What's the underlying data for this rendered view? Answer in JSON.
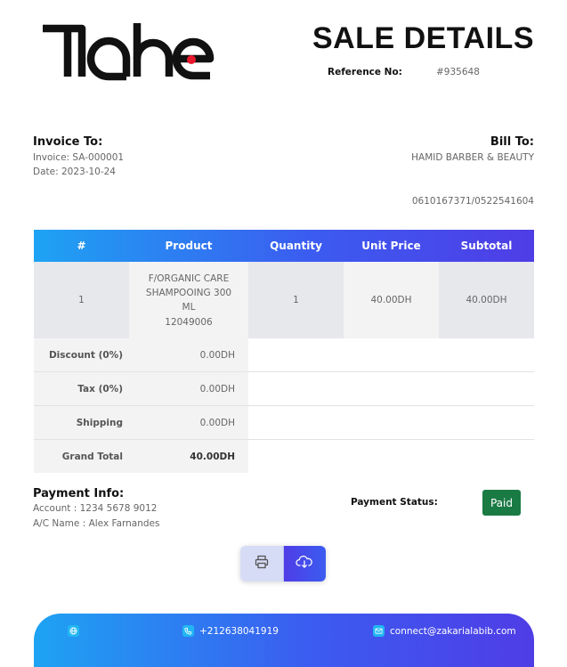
{
  "brand": {
    "logo_text": "Tahe",
    "accent_color": "#e8192c"
  },
  "header": {
    "title": "SALE DETAILS",
    "reference_label": "Reference No:",
    "reference_value": "#935648"
  },
  "invoice_to": {
    "heading": "Invoice To:",
    "invoice": "Invoice: SA-000001",
    "date": "Date: 2023-10-24"
  },
  "bill_to": {
    "heading": "Bill To:",
    "name": "HAMID BARBER & BEAUTY",
    "phone": "0610167371/0522541604"
  },
  "table": {
    "headers": [
      "#",
      "Product",
      "Quantity",
      "Unit Price",
      "Subtotal"
    ],
    "rows": [
      {
        "num": "1",
        "product_line1": "F/ORGANIC CARE",
        "product_line2": "SHAMPOOING 300",
        "product_line3": "ML",
        "product_code": "12049006",
        "quantity": "1",
        "unit_price": "40.00DH",
        "subtotal": "40.00DH"
      }
    ]
  },
  "summary": [
    {
      "label": "Discount (0%)",
      "value": "0.00DH"
    },
    {
      "label": "Tax (0%)",
      "value": "0.00DH"
    },
    {
      "label": "Shipping",
      "value": "0.00DH"
    },
    {
      "label": "Grand Total",
      "value": "40.00DH"
    }
  ],
  "payment": {
    "heading": "Payment Info:",
    "account": "Account : 1234 5678 9012",
    "ac_name": "A/C Name : Alex Farnandes",
    "status_label": "Payment Status:",
    "status_value": "Paid",
    "status_color": "#1a7a44"
  },
  "actions": {
    "print_icon": "printer-icon",
    "download_icon": "cloud-download-icon"
  },
  "footer": {
    "phone": "+212638041919",
    "email": "connect@zakarialabib.com",
    "icons": [
      "globe-icon",
      "phone-icon",
      "mail-icon"
    ]
  }
}
